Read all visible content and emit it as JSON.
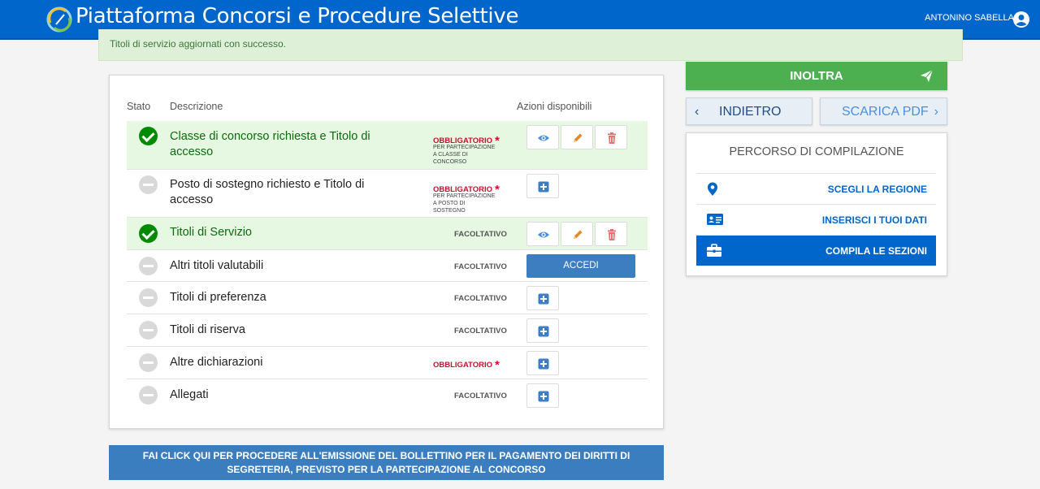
{
  "header": {
    "title": "Piattaforma Concorsi e Procedure Selettive",
    "user_name": "ANTONINO SABELLA"
  },
  "alert": {
    "message": "Titoli di servizio aggiornati con successo."
  },
  "table": {
    "headers": {
      "stato": "Stato",
      "descrizione": "Descrizione",
      "azioni": "Azioni disponibili"
    },
    "rows": [
      {
        "status": "completed",
        "description": "Classe di concorso richiesta e Titolo di accesso",
        "requirement": "OBBLIGATORIO",
        "note": "PER PARTECIPAZIONE A CLASSE DI CONCORSO",
        "actions": [
          "view",
          "edit",
          "delete"
        ]
      },
      {
        "status": "empty",
        "description": "Posto di sostegno richiesto e Titolo di accesso",
        "requirement": "OBBLIGATORIO",
        "note": "PER PARTECIPAZIONE A POSTO DI SOSTEGNO",
        "actions": [
          "add"
        ]
      },
      {
        "status": "completed",
        "description": "Titoli di Servizio",
        "requirement": "FACOLTATIVO",
        "actions": [
          "view",
          "edit",
          "delete"
        ]
      },
      {
        "status": "empty",
        "description": "Altri titoli valutabili",
        "requirement": "FACOLTATIVO",
        "actions": [
          "accedi"
        ],
        "accedi_label": "ACCEDI"
      },
      {
        "status": "empty",
        "description": "Titoli di preferenza",
        "requirement": "FACOLTATIVO",
        "actions": [
          "add"
        ]
      },
      {
        "status": "empty",
        "description": "Titoli di riserva",
        "requirement": "FACOLTATIVO",
        "actions": [
          "add"
        ]
      },
      {
        "status": "empty",
        "description": "Altre dichiarazioni",
        "requirement": "OBBLIGATORIO",
        "actions": [
          "add"
        ]
      },
      {
        "status": "empty",
        "description": "Allegati",
        "requirement": "FACOLTATIVO",
        "actions": [
          "add"
        ]
      }
    ],
    "required_marker": "*"
  },
  "payment_button": {
    "line1": "FAI CLICK QUI PER PROCEDERE ALL'EMISSIONE DEL BOLLETTINO PER IL PAGAMENTO DEI DIRITTI DI",
    "line2": "SEGRETERIA, PREVISTO PER LA PARTECIPAZIONE AL CONCORSO"
  },
  "sidebar": {
    "inoltra_label": "INOLTRA",
    "back_label": "INDIETRO",
    "pdf_label": "SCARICA PDF",
    "percorso_title": "PERCORSO DI COMPILAZIONE",
    "steps": [
      {
        "label": "SCEGLI LA REGIONE",
        "icon": "map-marker-icon",
        "active": false
      },
      {
        "label": "INSERISCI I TUOI DATI",
        "icon": "id-card-icon",
        "active": false
      },
      {
        "label": "COMPILA LE SEZIONI",
        "icon": "briefcase-icon",
        "active": true
      }
    ]
  },
  "colors": {
    "primary": "#0066cc",
    "success": "#4caf50",
    "completed_row": "#e6f7e2",
    "required": "#c8102e"
  }
}
